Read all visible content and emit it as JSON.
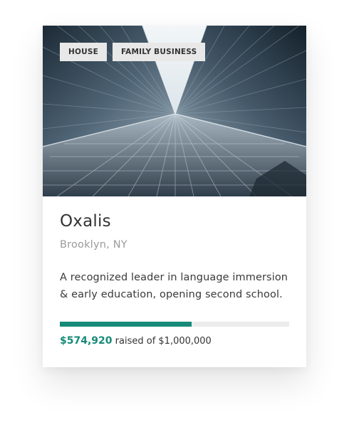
{
  "card": {
    "tags": [
      "HOUSE",
      "FAMILY BUSINESS"
    ],
    "title": "Oxalis",
    "location": "Brooklyn, NY",
    "description": "A recognized leader in language immersion & early education, opening second school.",
    "progress": {
      "fraction": 0.5749,
      "raised": "$574,920",
      "raised_text": "raised of $1,000,000"
    },
    "colors": {
      "accent": "#168b78",
      "track": "#ececec",
      "tag_bg": "#e8e8e8"
    },
    "image": "glass-skyscraper-photo"
  }
}
